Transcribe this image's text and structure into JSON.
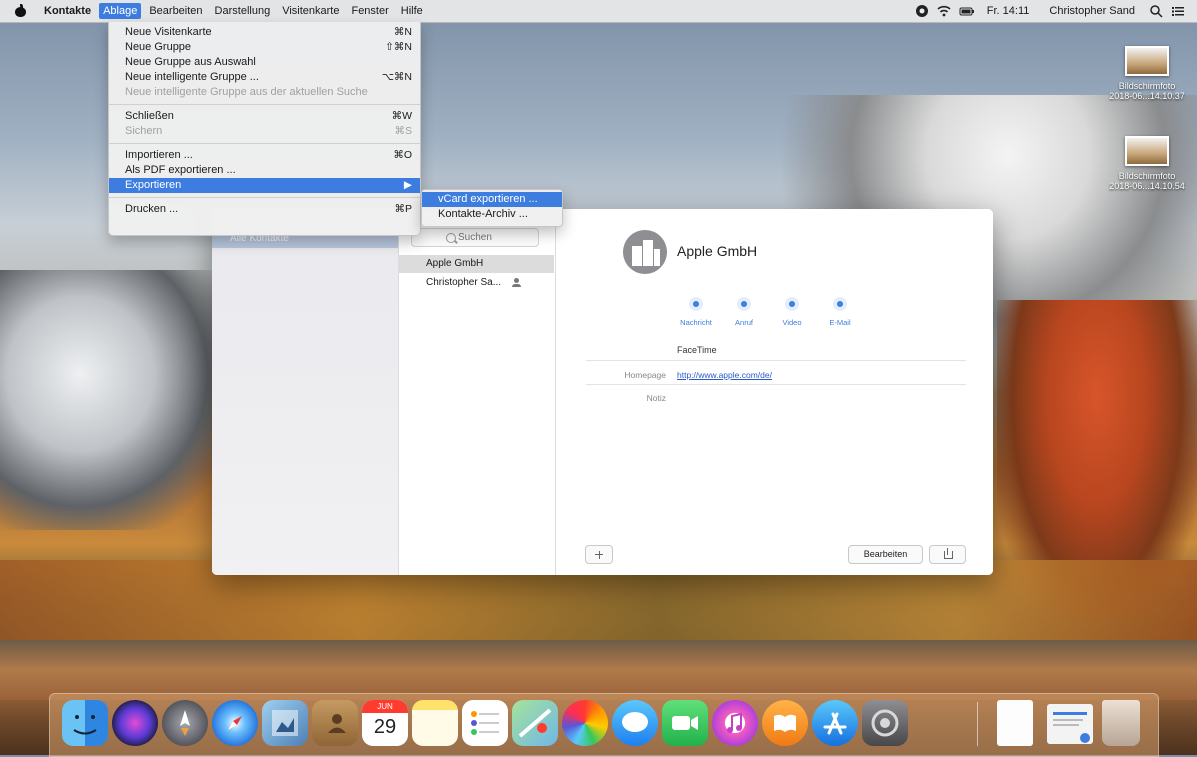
{
  "menubar": {
    "app_name": "Kontakte",
    "menus": [
      "Ablage",
      "Bearbeiten",
      "Darstellung",
      "Visitenkarte",
      "Fenster",
      "Hilfe"
    ],
    "clock": "Fr. 14:11",
    "user": "Christopher Sand"
  },
  "file_menu": {
    "items": [
      {
        "label": "Neue Visitenkarte",
        "shortcut": "⌘N"
      },
      {
        "label": "Neue Gruppe",
        "shortcut": "⇧⌘N"
      },
      {
        "label": "Neue Gruppe aus Auswahl",
        "shortcut": ""
      },
      {
        "label": "Neue intelligente Gruppe ...",
        "shortcut": "⌥⌘N"
      },
      {
        "label": "Neue intelligente Gruppe aus der aktuellen Suche",
        "shortcut": ""
      },
      {
        "label": "Schließen",
        "shortcut": "⌘W"
      },
      {
        "label": "Sichern",
        "shortcut": "⌘S"
      },
      {
        "label": "Importieren ...",
        "shortcut": "⌘O"
      },
      {
        "label": "Als PDF exportieren ...",
        "shortcut": ""
      },
      {
        "label": "Exportieren",
        "shortcut": "▶"
      },
      {
        "label": "Drucken ...",
        "shortcut": "⌘P"
      }
    ]
  },
  "export_submenu": {
    "items": [
      "vCard exportieren ...",
      "Kontakte-Archiv ..."
    ]
  },
  "contacts_window": {
    "sidebar_selected": "Alle Kontakte",
    "search_placeholder": "Suchen",
    "contacts": [
      "Apple GmbH",
      "Christopher Sa..."
    ],
    "detail": {
      "name": "Apple GmbH",
      "actions": [
        "Nachricht",
        "Anruf",
        "Video",
        "E-Mail"
      ],
      "facetime": "FaceTime",
      "homepage_label": "Homepage",
      "homepage_value": "http://www.apple.com/de/",
      "note_label": "Notiz",
      "edit_button": "Bearbeiten"
    }
  },
  "desktop_files": [
    {
      "name": "Bildschirmfoto",
      "date": "2018-06...14.10.37"
    },
    {
      "name": "Bildschirmfoto",
      "date": "2018-06...14.10.54"
    }
  ],
  "dock": {
    "calendar_month": "JUN",
    "calendar_day": "29",
    "apps": [
      "finder-icon",
      "siri-icon",
      "launchpad-icon",
      "safari-icon",
      "preview-icon",
      "contacts-icon",
      "calendar-icon",
      "notes-icon",
      "reminders-icon",
      "maps-icon",
      "photos-icon",
      "messages-icon",
      "facetime-icon",
      "itunes-icon",
      "ibooks-icon",
      "app-store-icon",
      "system-preferences-icon",
      "document-icon",
      "downloads-icon",
      "trash-icon"
    ]
  }
}
